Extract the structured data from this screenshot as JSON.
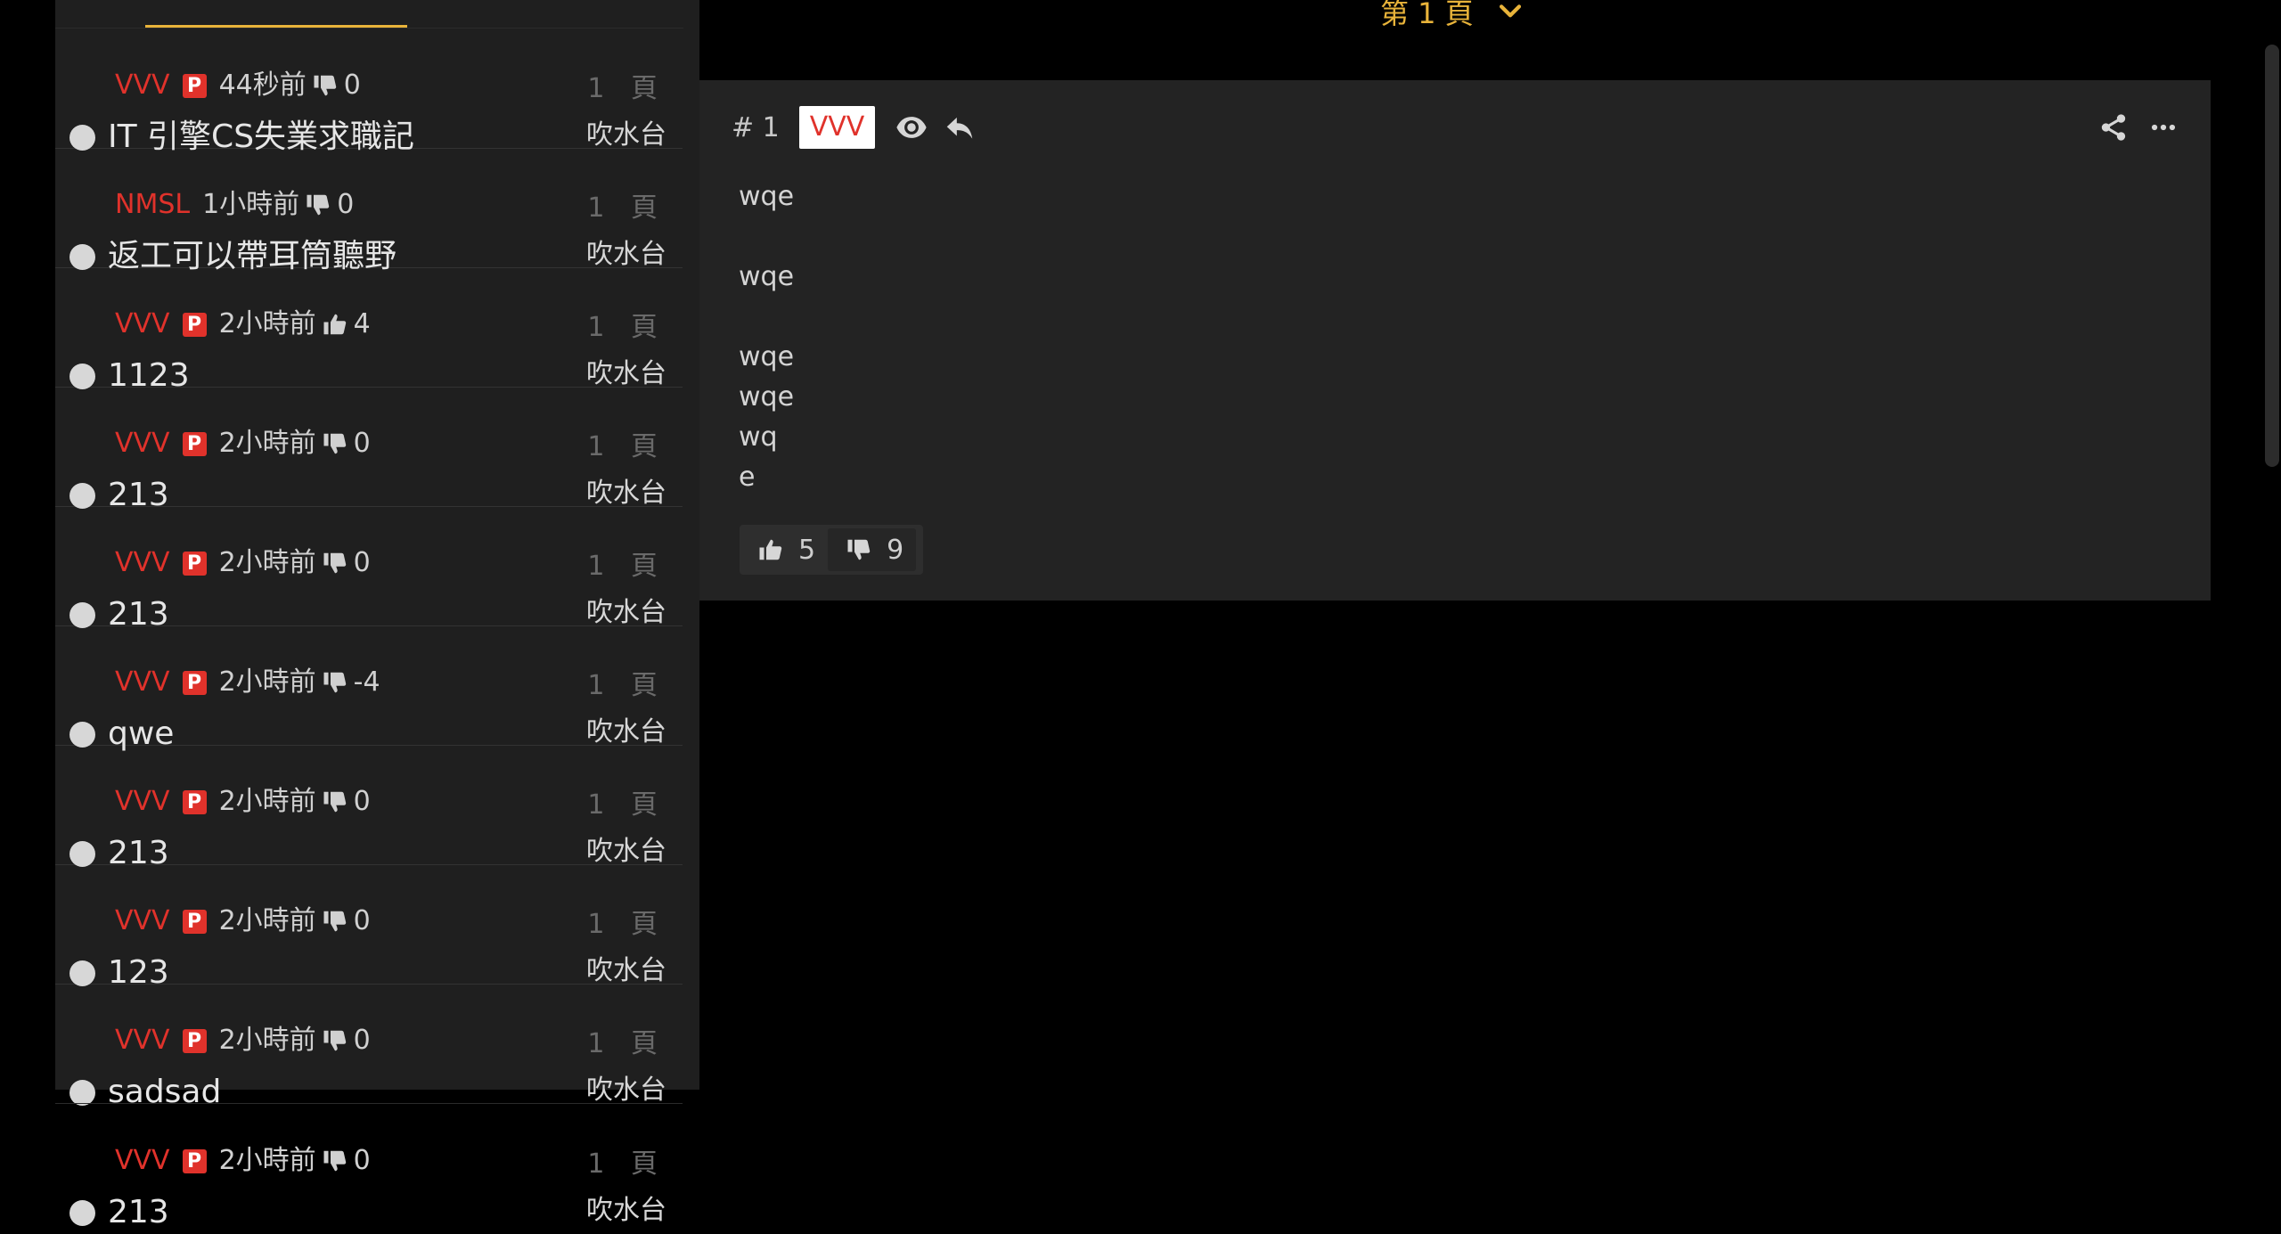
{
  "page_selector": {
    "label": "第 1 頁"
  },
  "threads": [
    {
      "author": "VVV",
      "badge": "P",
      "time": "44秒前",
      "vote": "down",
      "score": "0",
      "title": "IT 引擎CS失業求職記",
      "pages": "1 頁",
      "board": "吹水台"
    },
    {
      "author": "NMSL",
      "badge": "",
      "time": "1小時前",
      "vote": "down",
      "score": "0",
      "title": "返工可以帶耳筒聽野",
      "pages": "1 頁",
      "board": "吹水台"
    },
    {
      "author": "VVV",
      "badge": "P",
      "time": "2小時前",
      "vote": "up",
      "score": "4",
      "title": "1123",
      "pages": "1 頁",
      "board": "吹水台"
    },
    {
      "author": "VVV",
      "badge": "P",
      "time": "2小時前",
      "vote": "down",
      "score": "0",
      "title": "213",
      "pages": "1 頁",
      "board": "吹水台"
    },
    {
      "author": "VVV",
      "badge": "P",
      "time": "2小時前",
      "vote": "down",
      "score": "0",
      "title": "213",
      "pages": "1 頁",
      "board": "吹水台"
    },
    {
      "author": "VVV",
      "badge": "P",
      "time": "2小時前",
      "vote": "down",
      "score": "-4",
      "title": "qwe",
      "pages": "1 頁",
      "board": "吹水台"
    },
    {
      "author": "VVV",
      "badge": "P",
      "time": "2小時前",
      "vote": "down",
      "score": "0",
      "title": "213",
      "pages": "1 頁",
      "board": "吹水台"
    },
    {
      "author": "VVV",
      "badge": "P",
      "time": "2小時前",
      "vote": "down",
      "score": "0",
      "title": "123",
      "pages": "1 頁",
      "board": "吹水台"
    },
    {
      "author": "VVV",
      "badge": "P",
      "time": "2小時前",
      "vote": "down",
      "score": "0",
      "title": "sadsad",
      "pages": "1 頁",
      "board": "吹水台"
    },
    {
      "author": "VVV",
      "badge": "P",
      "time": "2小時前",
      "vote": "down",
      "score": "0",
      "title": "213",
      "pages": "1 頁",
      "board": "吹水台"
    }
  ],
  "post": {
    "number": "# 1",
    "author": "VVV",
    "body_lines": [
      "wqe",
      "",
      "wqe",
      "",
      "wqe",
      "wqe",
      "wq",
      "e"
    ],
    "likes": "5",
    "dislikes": "9"
  },
  "colors": {
    "accent": "#e8b33a",
    "author": "#e0322b",
    "panel": "#232323",
    "sidebar": "#1f1f1f"
  },
  "icons": {
    "eye": "eye-icon",
    "reply": "reply-icon",
    "share": "share-icon",
    "more": "more-icon",
    "like": "thumbs-up-icon",
    "dislike": "thumbs-down-icon",
    "chevron": "chevron-down-icon"
  }
}
